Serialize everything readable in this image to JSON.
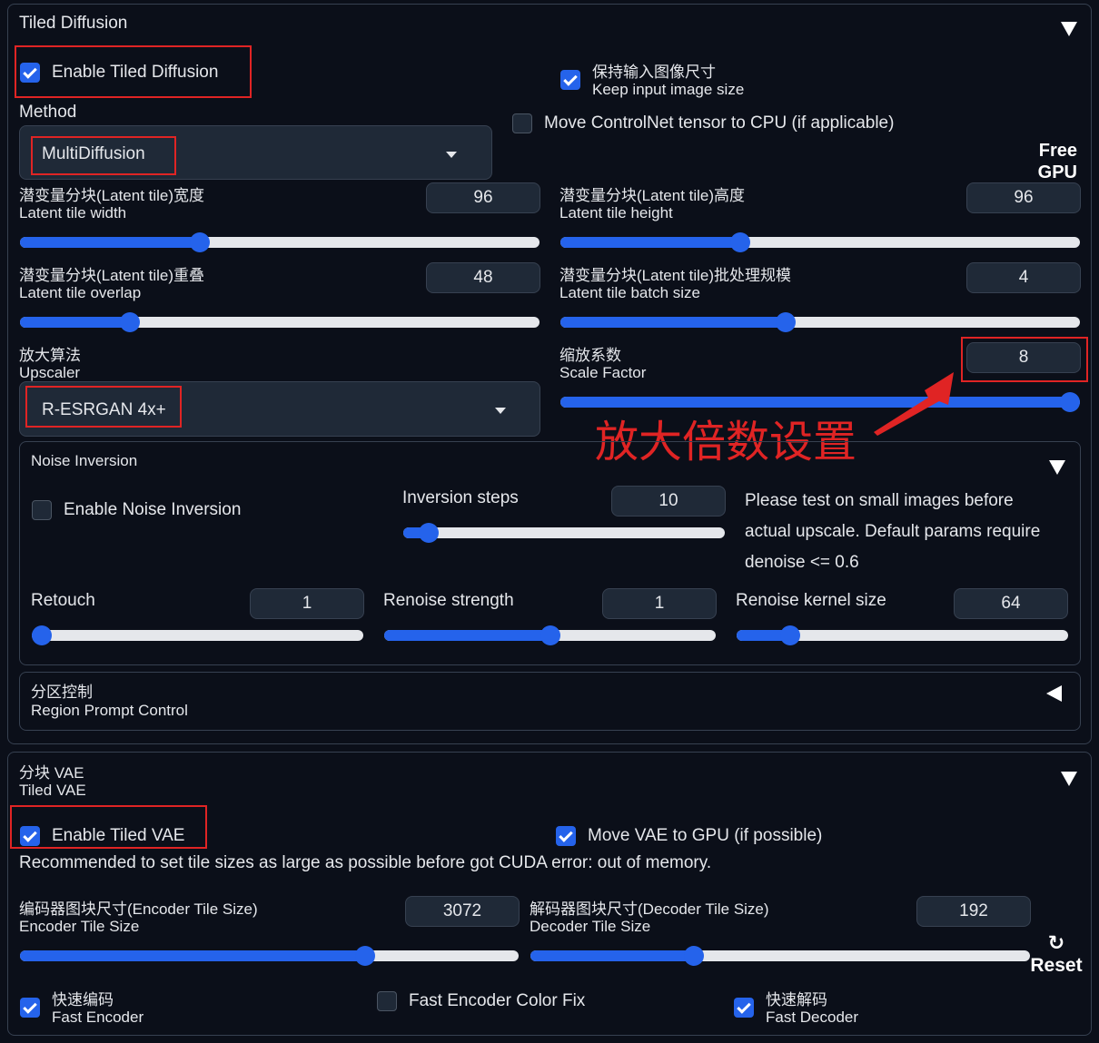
{
  "tiled_diffusion": {
    "title": "Tiled Diffusion",
    "enable_label": "Enable Tiled Diffusion",
    "enable_checked": true,
    "keep_size_cn": "保持输入图像尺寸",
    "keep_size_en": "Keep input image size",
    "keep_size_checked": true,
    "method_label": "Method",
    "method_value": "MultiDiffusion",
    "controlnet_label": "Move ControlNet tensor to CPU (if applicable)",
    "controlnet_checked": false,
    "free_gpu_label_1": "Free",
    "free_gpu_label_2": "GPU",
    "tile_width_cn": "潜变量分块(Latent tile)宽度",
    "tile_width_en": "Latent tile width",
    "tile_width": "96",
    "tile_width_level": 0.34,
    "tile_height_cn": "潜变量分块(Latent tile)高度",
    "tile_height_en": "Latent tile height",
    "tile_height": "96",
    "tile_height_level": 0.34,
    "tile_overlap_cn": "潜变量分块(Latent tile)重叠",
    "tile_overlap_en": "Latent tile overlap",
    "tile_overlap": "48",
    "tile_overlap_level": 0.2,
    "tile_batch_cn": "潜变量分块(Latent tile)批处理规模",
    "tile_batch_en": "Latent tile batch size",
    "tile_batch": "4",
    "tile_batch_level": 0.43,
    "upscaler_cn": "放大算法",
    "upscaler_en": "Upscaler",
    "upscaler_value": "R-ESRGAN 4x+",
    "scale_cn": "缩放系数",
    "scale_en": "Scale Factor",
    "scale_factor": "8",
    "scale_factor_level": 1.0,
    "annotation": "放大倍数设置"
  },
  "noise_inversion": {
    "title": "Noise Inversion",
    "enable_label": "Enable Noise Inversion",
    "enable_checked": false,
    "steps_label": "Inversion steps",
    "steps": "10",
    "steps_level": 0.05,
    "note_line1": "Please test on small images before",
    "note_line2": "actual upscale. Default params require",
    "note_line3": "denoise <= 0.6",
    "retouch_label": "Retouch",
    "retouch": "1",
    "retouch_level": 0.0,
    "renoise_label": "Renoise strength",
    "renoise": "1",
    "renoise_level": 0.5,
    "kernel_label": "Renoise kernel size",
    "kernel": "64",
    "kernel_level": 0.14
  },
  "region_control": {
    "title_cn": "分区控制",
    "title_en": "Region Prompt Control"
  },
  "tiled_vae": {
    "title_cn": "分块 VAE",
    "title_en": "Tiled VAE",
    "enable_label": "Enable Tiled VAE",
    "enable_checked": true,
    "move_gpu_label": "Move VAE to GPU (if possible)",
    "move_gpu_checked": true,
    "recommend": "Recommended to set tile sizes as large as possible before got CUDA error: out of memory.",
    "encoder_cn": "编码器图块尺寸(Encoder Tile Size)",
    "encoder_en": "Encoder Tile Size",
    "encoder": "3072",
    "encoder_level": 0.7,
    "decoder_cn": "解码器图块尺寸(Decoder Tile Size)",
    "decoder_en": "Decoder Tile Size",
    "decoder": "192",
    "decoder_level": 0.32,
    "reset_icon": "↻",
    "reset_label": "Reset",
    "fast_encoder_cn": "快速编码",
    "fast_encoder_en": "Fast Encoder",
    "fast_encoder_checked": true,
    "color_fix_label": "Fast Encoder Color Fix",
    "color_fix_checked": false,
    "fast_decoder_cn": "快速解码",
    "fast_decoder_en": "Fast Decoder",
    "fast_decoder_checked": true
  },
  "colors": {
    "accent": "#2563eb",
    "background": "#0b0f19",
    "annotation_red": "#e02424"
  }
}
